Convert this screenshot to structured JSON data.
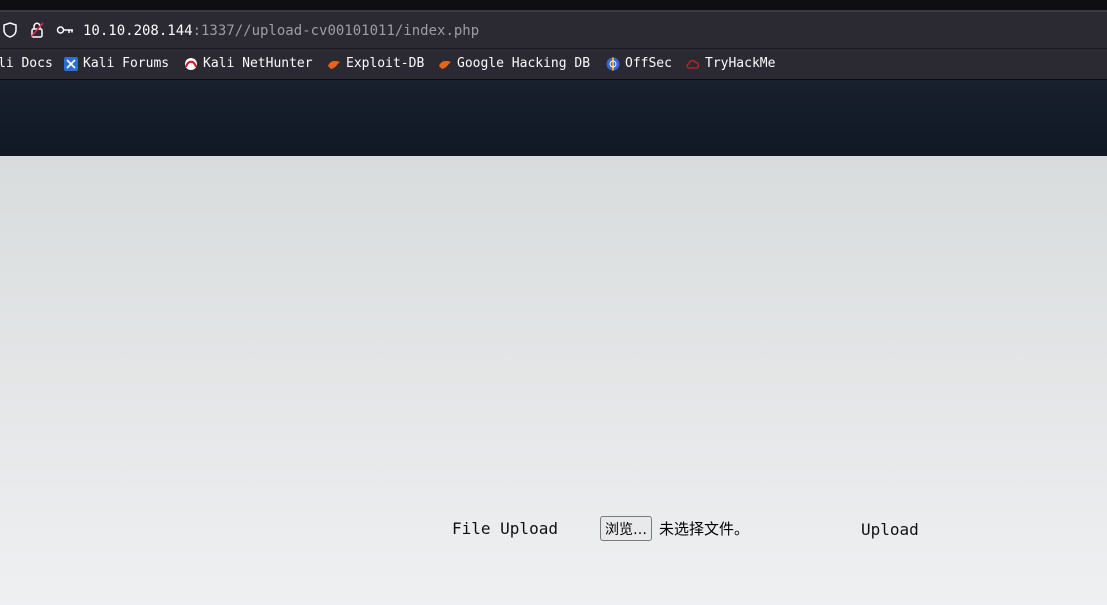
{
  "browser": {
    "url_host": "10.10.208.144",
    "url_path": ":1337//upload-cv00101011/index.php",
    "bookmarks": [
      {
        "label": "li Docs"
      },
      {
        "label": "Kali Forums"
      },
      {
        "label": "Kali NetHunter"
      },
      {
        "label": "Exploit-DB"
      },
      {
        "label": "Google Hacking DB"
      },
      {
        "label": "OffSec"
      },
      {
        "label": "TryHackMe"
      }
    ]
  },
  "page": {
    "file_upload_label": "File Upload",
    "browse_button_label": "浏览…",
    "no_file_text": "未选择文件。",
    "upload_button_label": "Upload"
  }
}
